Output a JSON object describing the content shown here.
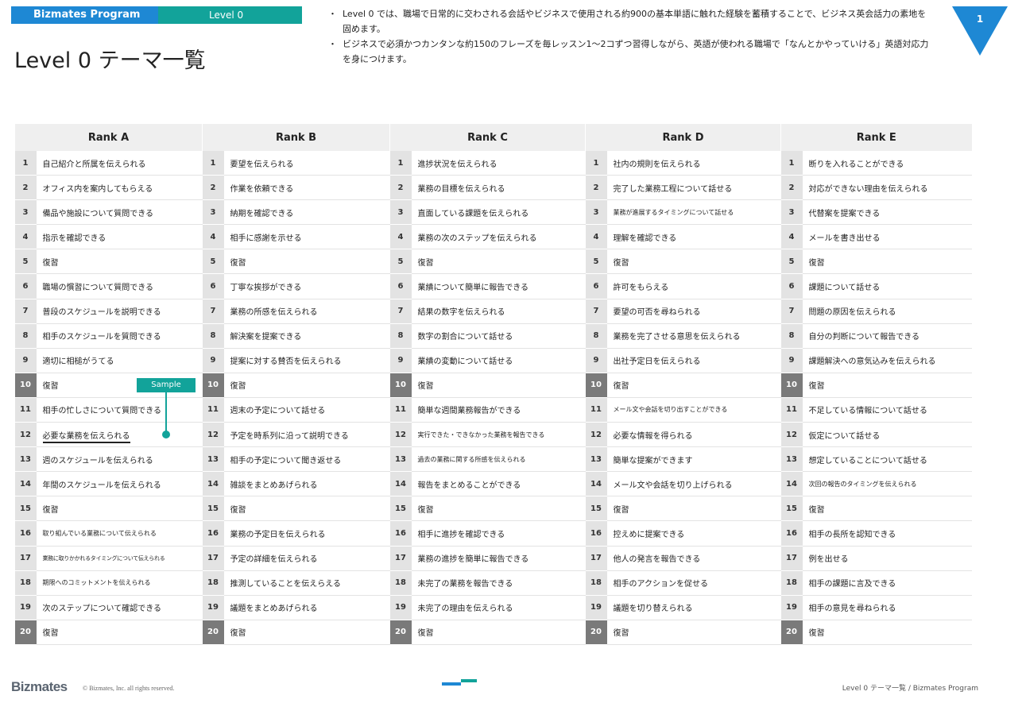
{
  "header": {
    "program_name": "Bizmates Program",
    "level": "Level 0",
    "title": "Level 0 テーマ一覧",
    "bullet_symbol": "・",
    "descriptions": [
      "Level 0 では、職場で日常的に交わされる会話やビジネスで使用される約900の基本単語に触れた経験を蓄積することで、ビジネス英会話力の素地を固めます。",
      "ビジネスで必須かつカンタンな約150のフレーズを毎レッスン1〜2コずつ習得しながら、英語が使われる職場で「なんとかやっていける」英語対応力を身につけます。"
    ],
    "page_number": "1",
    "accent_blue": "#1e88d4",
    "accent_teal": "#12a39a"
  },
  "table": {
    "ranks": [
      "Rank A",
      "Rank B",
      "Rank C",
      "Rank D",
      "Rank E"
    ],
    "rows": [
      {
        "num": "1",
        "items": [
          "自己紹介と所属を伝えられる",
          "要望を伝えられる",
          "進捗状況を伝えられる",
          "社内の規則を伝えられる",
          "断りを入れることができる"
        ]
      },
      {
        "num": "2",
        "items": [
          "オフィス内を案内してもらえる",
          "作業を依頼できる",
          "業務の目標を伝えられる",
          "完了した業務工程について話せる",
          "対応ができない理由を伝えられる"
        ]
      },
      {
        "num": "3",
        "items": [
          "備品や施設について質問できる",
          "納期を確認できる",
          "直面している課題を伝えられる",
          "業務が進展するタイミングについて話せる",
          "代替案を提案できる"
        ]
      },
      {
        "num": "4",
        "items": [
          "指示を確認できる",
          "相手に感謝を示せる",
          "業務の次のステップを伝えられる",
          "理解を確認できる",
          "メールを書き出せる"
        ]
      },
      {
        "num": "5",
        "items": [
          "復習",
          "復習",
          "復習",
          "復習",
          "復習"
        ]
      },
      {
        "num": "6",
        "items": [
          "職場の慣習について質問できる",
          "丁寧な挨拶ができる",
          "業績について簡単に報告できる",
          "許可をもらえる",
          "課題について話せる"
        ]
      },
      {
        "num": "7",
        "items": [
          "普段のスケジュールを説明できる",
          "業務の所感を伝えられる",
          "結果の数字を伝えられる",
          "要望の可否を尋ねられる",
          "問題の原因を伝えられる"
        ]
      },
      {
        "num": "8",
        "items": [
          "相手のスケジュールを質問できる",
          "解決案を提案できる",
          "数字の割合について話せる",
          "業務を完了させる意思を伝えられる",
          "自分の判断について報告できる"
        ]
      },
      {
        "num": "9",
        "items": [
          "適切に相槌がうてる",
          "提案に対する賛否を伝えられる",
          "業績の変動について話せる",
          "出社予定日を伝えられる",
          "課題解決への意気込みを伝えられる"
        ]
      },
      {
        "num": "10",
        "items": [
          "復習",
          "復習",
          "復習",
          "復習",
          "復習"
        ]
      },
      {
        "num": "11",
        "items": [
          "相手の忙しさについて質問できる",
          "週末の予定について話せる",
          "簡単な週間業務報告ができる",
          "メール文や会話を切り出すことができる",
          "不足している情報について話せる"
        ]
      },
      {
        "num": "12",
        "items": [
          "必要な業務を伝えられる",
          "予定を時系列に沿って説明できる",
          "実行できた・できなかった業務を報告できる",
          "必要な情報を得られる",
          "仮定について話せる"
        ]
      },
      {
        "num": "13",
        "items": [
          "週のスケジュールを伝えられる",
          "相手の予定について聞き返せる",
          "過去の業務に関する所感を伝えられる",
          "簡単な提案ができます",
          "想定していることについて話せる"
        ]
      },
      {
        "num": "14",
        "items": [
          "年間のスケジュールを伝えられる",
          "雑談をまとめあげられる",
          "報告をまとめることができる",
          "メール文や会話を切り上げられる",
          "次回の報告のタイミングを伝えられる"
        ]
      },
      {
        "num": "15",
        "items": [
          "復習",
          "復習",
          "復習",
          "復習",
          "復習"
        ]
      },
      {
        "num": "16",
        "items": [
          "取り組んでいる業務について伝えられる",
          "業務の予定日を伝えられる",
          "相手に進捗を確認できる",
          "控えめに提案できる",
          "相手の長所を認知できる"
        ]
      },
      {
        "num": "17",
        "items": [
          "業務に取りかかれるタイミングについて伝えられる",
          "予定の詳細を伝えられる",
          "業務の進捗を簡単に報告できる",
          "他人の発言を報告できる",
          "例を出せる"
        ]
      },
      {
        "num": "18",
        "items": [
          "期限へのコミットメントを伝えられる",
          "推測していることを伝えらえる",
          "未完了の業務を報告できる",
          "相手のアクションを促せる",
          "相手の課題に言及できる"
        ]
      },
      {
        "num": "19",
        "items": [
          "次のステップについて確認できる",
          "議題をまとめあげられる",
          "未完了の理由を伝えられる",
          "議題を切り替えられる",
          "相手の意見を尋ねられる"
        ]
      },
      {
        "num": "20",
        "items": [
          "復習",
          "復習",
          "復習",
          "復習",
          "復習"
        ]
      }
    ]
  },
  "sample": {
    "label": "Sample"
  },
  "footer": {
    "logo": "Bizmates",
    "copyright": "© Bizmates, Inc. all rights reserved.",
    "page_label": "Level 0 テーマ一覧 / Bizmates Program"
  }
}
